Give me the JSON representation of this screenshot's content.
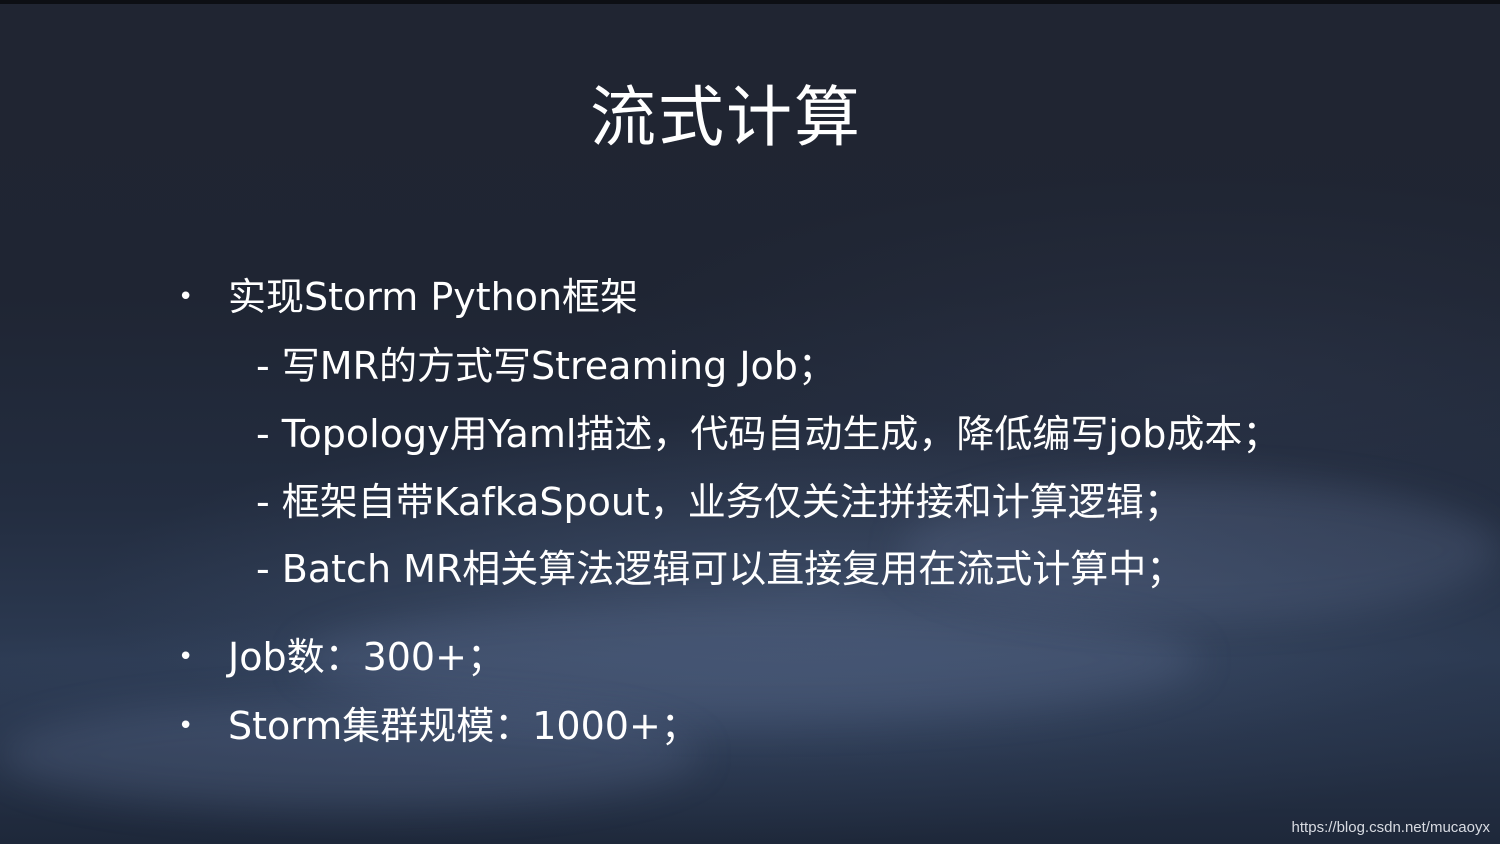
{
  "slide": {
    "title": "流式计算",
    "bullets": [
      {
        "marker": "•",
        "text": "实现Storm Python框架",
        "sub_items": [
          "- 写MR的方式写Streaming Job；",
          "- Topology用Yaml描述，代码自动生成，降低编写job成本；",
          "- 框架自带KafkaSpout，业务仅关注拼接和计算逻辑；",
          "- Batch MR相关算法逻辑可以直接复用在流式计算中；"
        ]
      },
      {
        "marker": "•",
        "text": "Job数：300+；"
      },
      {
        "marker": "•",
        "text": "Storm集群规模：1000+；"
      }
    ]
  },
  "watermark": "https://blog.csdn.net/mucaoyx"
}
